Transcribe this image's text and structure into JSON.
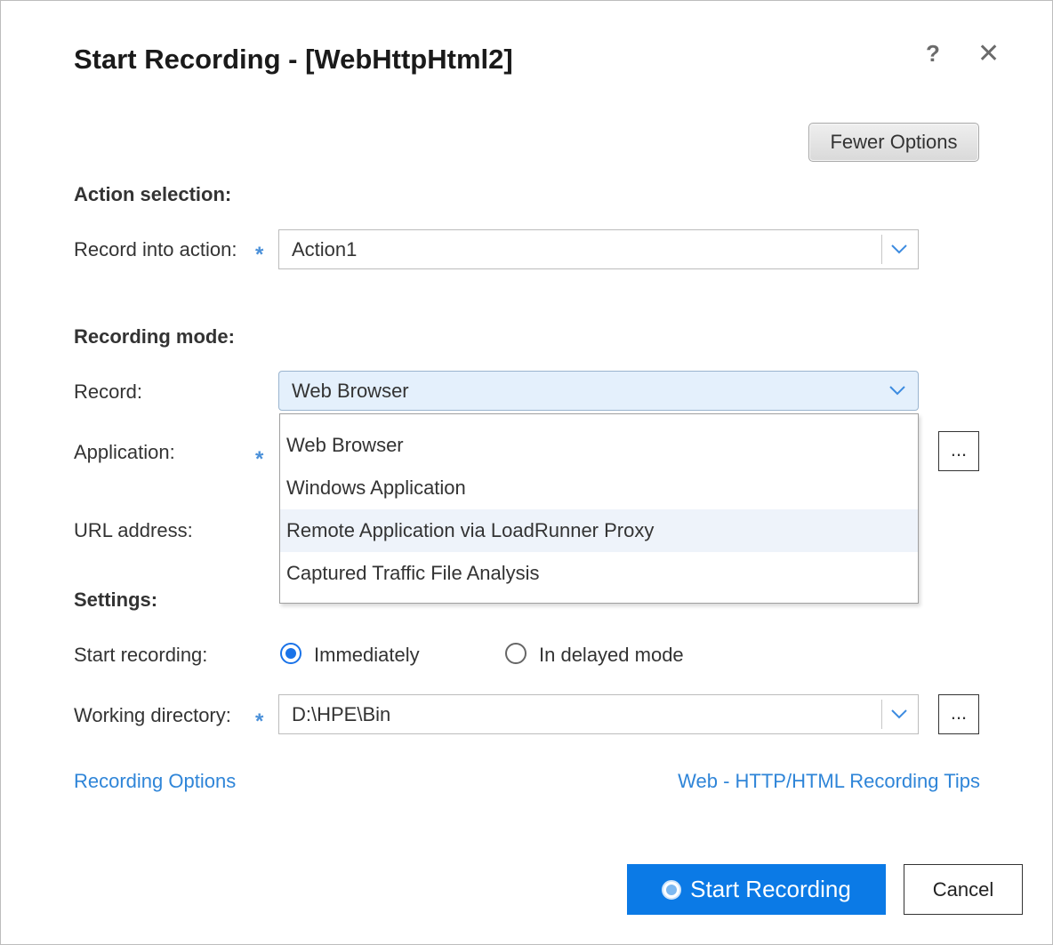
{
  "dialog": {
    "title": "Start Recording - [WebHttpHtml2]",
    "help_glyph": "?",
    "close_glyph": "✕",
    "fewer_options_label": "Fewer Options"
  },
  "action_selection": {
    "heading": "Action selection:",
    "record_into_label": "Record into action:",
    "required_mark": "*",
    "record_into_value": "Action1"
  },
  "recording_mode": {
    "heading": "Recording mode:",
    "record_label": "Record:",
    "record_value": "Web Browser",
    "application_label": "Application:",
    "url_label": "URL address:",
    "browse_label": "...",
    "options": [
      "Web Browser",
      "Windows Application",
      "Remote Application via LoadRunner Proxy",
      "Captured Traffic File Analysis"
    ]
  },
  "settings": {
    "heading": "Settings:",
    "start_recording_label": "Start recording:",
    "immediately_label": "Immediately",
    "delayed_label": "In delayed mode",
    "working_dir_label": "Working directory:",
    "working_dir_value": "D:\\HPE\\Bin"
  },
  "links": {
    "recording_options": "Recording Options",
    "tips": "Web - HTTP/HTML Recording Tips"
  },
  "footer": {
    "start_label": "Start Recording",
    "cancel_label": "Cancel"
  },
  "colors": {
    "accent": "#0b7ae6",
    "link": "#2f85d8",
    "required": "#4a90d9"
  }
}
